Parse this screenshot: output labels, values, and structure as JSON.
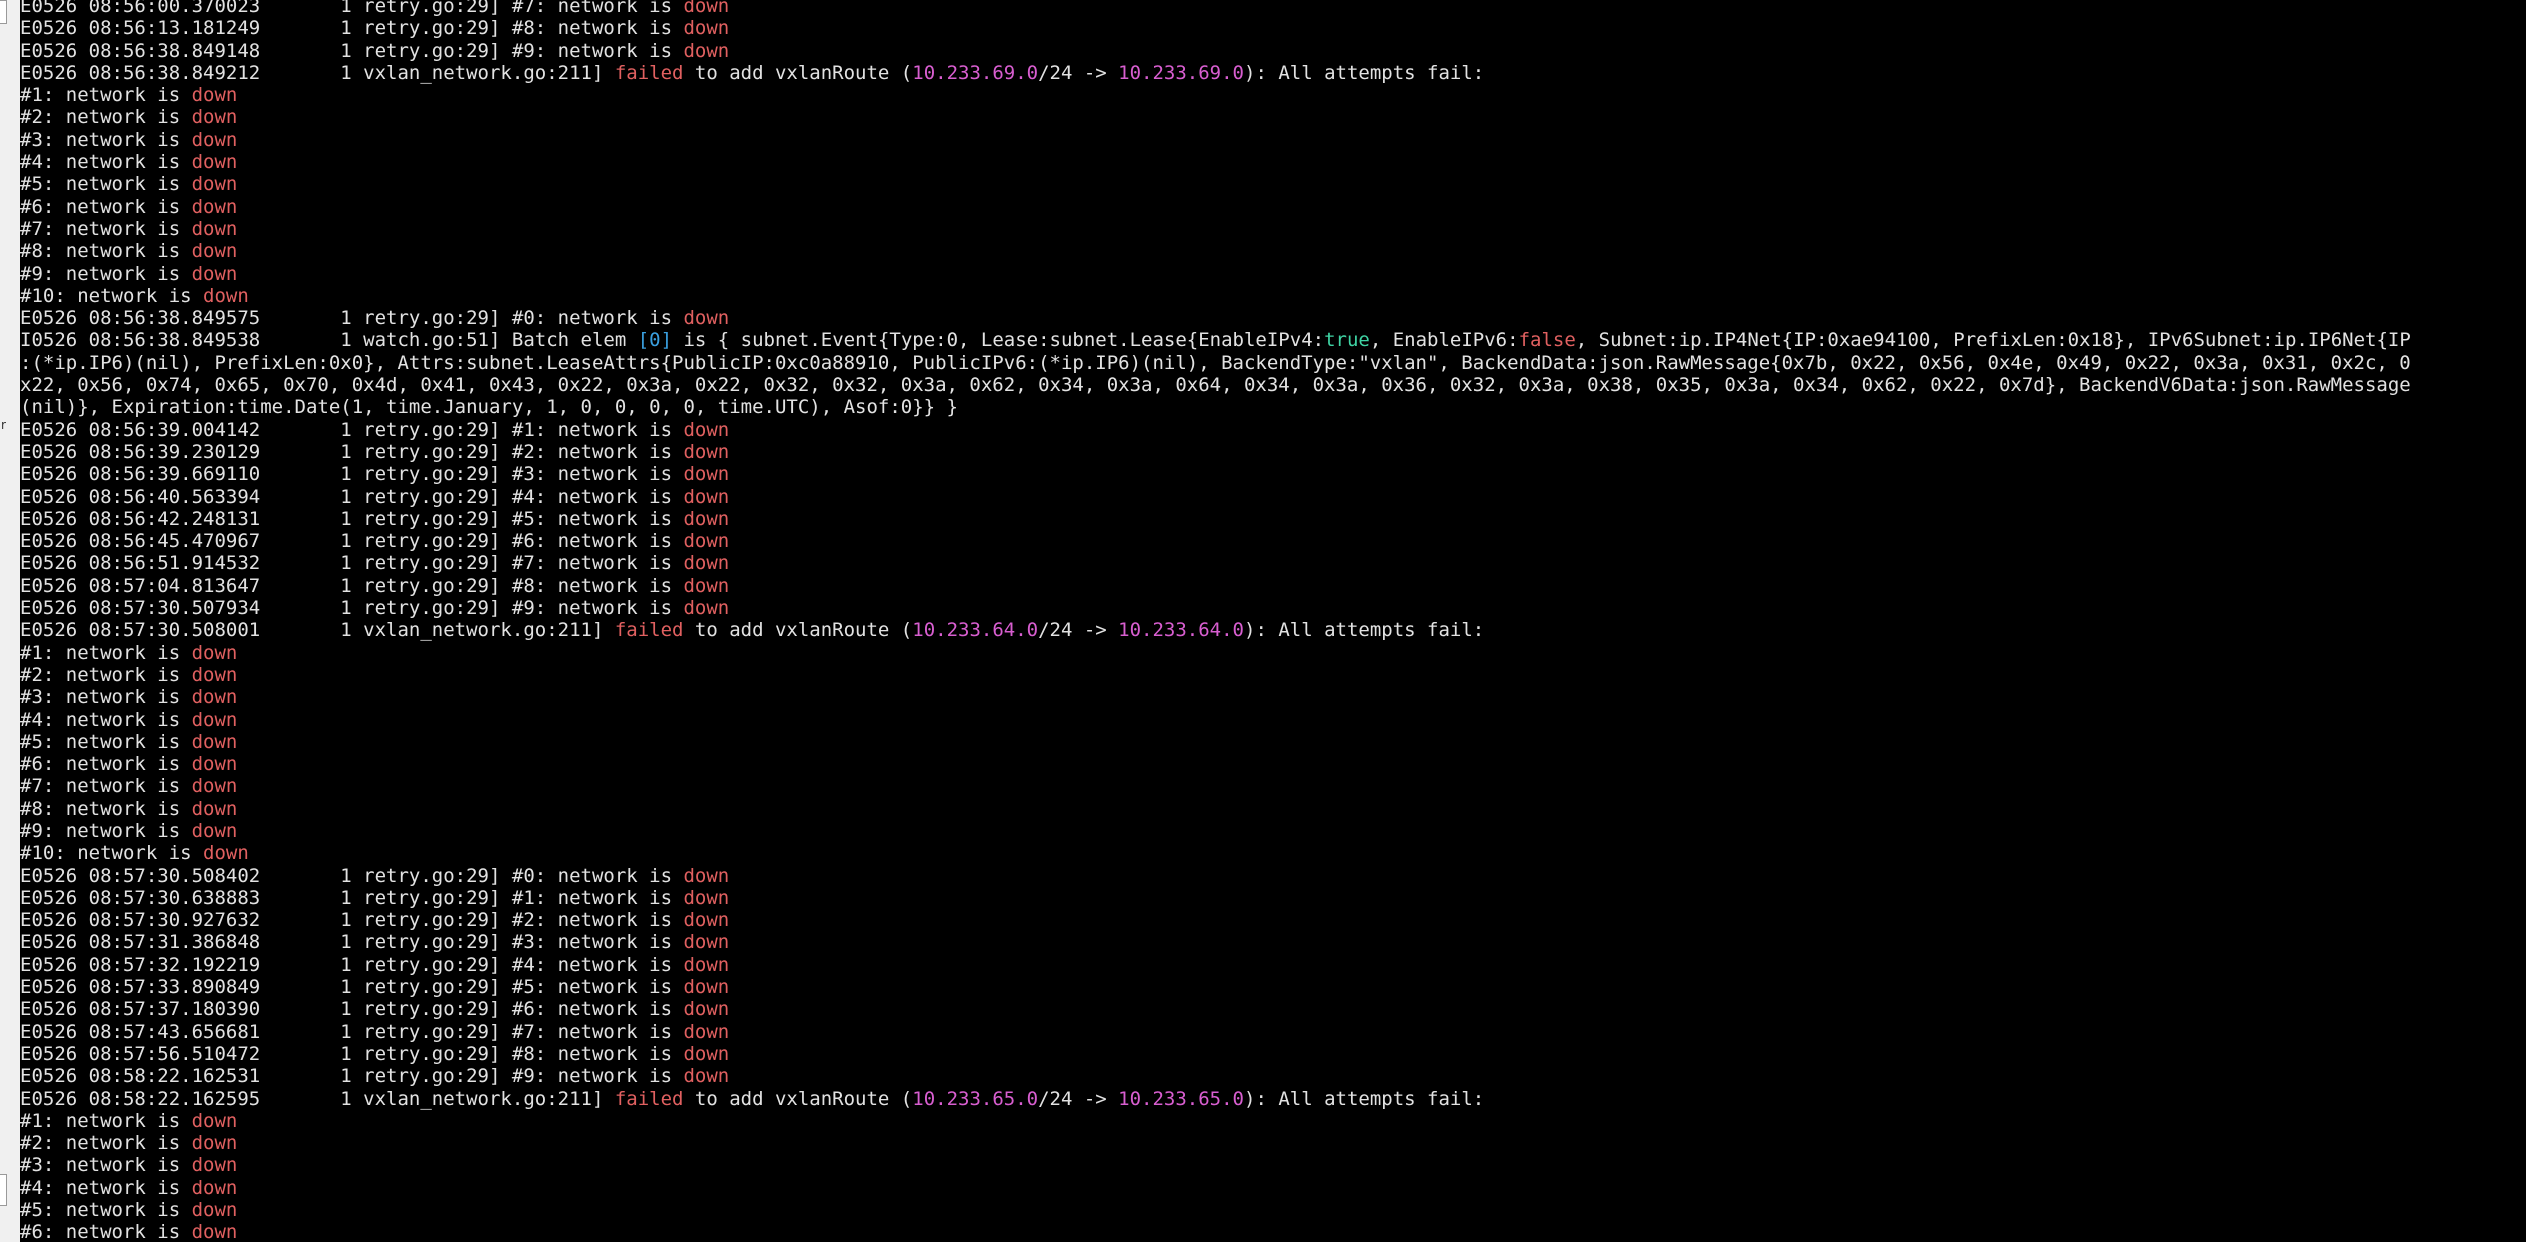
{
  "colors": {
    "background": "#000000",
    "text": "#e2e2e2",
    "red": "#e06060",
    "magenta": "#d85ed0",
    "green": "#3fd4a4",
    "cyan": "#3aa0e0"
  },
  "terminal": {
    "lines": [
      [
        [
          "E0526 08:56:00.370023       1 retry.go:29] #7: network is ",
          ""
        ],
        [
          "down",
          "red"
        ]
      ],
      [
        [
          "E0526 08:56:13.181249       1 retry.go:29] #8: network is ",
          ""
        ],
        [
          "down",
          "red"
        ]
      ],
      [
        [
          "E0526 08:56:38.849148       1 retry.go:29] #9: network is ",
          ""
        ],
        [
          "down",
          "red"
        ]
      ],
      [
        [
          "E0526 08:56:38.849212       1 vxlan_network.go:211] ",
          ""
        ],
        [
          "failed",
          "red"
        ],
        [
          " to add vxlanRoute (",
          ""
        ],
        [
          "10.233.69.0",
          "magenta"
        ],
        [
          "/24 -> ",
          ""
        ],
        [
          "10.233.69.0",
          "magenta"
        ],
        [
          "): All attempts fail:",
          ""
        ]
      ],
      [
        [
          "#1: network is ",
          ""
        ],
        [
          "down",
          "red"
        ]
      ],
      [
        [
          "#2: network is ",
          ""
        ],
        [
          "down",
          "red"
        ]
      ],
      [
        [
          "#3: network is ",
          ""
        ],
        [
          "down",
          "red"
        ]
      ],
      [
        [
          "#4: network is ",
          ""
        ],
        [
          "down",
          "red"
        ]
      ],
      [
        [
          "#5: network is ",
          ""
        ],
        [
          "down",
          "red"
        ]
      ],
      [
        [
          "#6: network is ",
          ""
        ],
        [
          "down",
          "red"
        ]
      ],
      [
        [
          "#7: network is ",
          ""
        ],
        [
          "down",
          "red"
        ]
      ],
      [
        [
          "#8: network is ",
          ""
        ],
        [
          "down",
          "red"
        ]
      ],
      [
        [
          "#9: network is ",
          ""
        ],
        [
          "down",
          "red"
        ]
      ],
      [
        [
          "#10: network is ",
          ""
        ],
        [
          "down",
          "red"
        ]
      ],
      [
        [
          "E0526 08:56:38.849575       1 retry.go:29] #0: network is ",
          ""
        ],
        [
          "down",
          "red"
        ]
      ],
      [
        [
          "I0526 08:56:38.849538       1 watch.go:51] Batch elem ",
          ""
        ],
        [
          "[0]",
          "cyan"
        ],
        [
          " is { subnet.Event{Type:0, Lease:subnet.Lease{EnableIPv4:",
          ""
        ],
        [
          "true",
          "green"
        ],
        [
          ", EnableIPv6:",
          ""
        ],
        [
          "false",
          "red"
        ],
        [
          ", Subnet:ip.IP4Net{IP:0xae94100, PrefixLen:0x18}, IPv6Subnet:ip.IP6Net{IP",
          ""
        ]
      ],
      [
        [
          ":(*ip.IP6)(nil), PrefixLen:0x0}, Attrs:subnet.LeaseAttrs{PublicIP:0xc0a88910, PublicIPv6:(*ip.IP6)(nil), BackendType:\"vxlan\", BackendData:json.RawMessage{0x7b, 0x22, 0x56, 0x4e, 0x49, 0x22, 0x3a, 0x31, 0x2c, 0",
          ""
        ]
      ],
      [
        [
          "x22, 0x56, 0x74, 0x65, 0x70, 0x4d, 0x41, 0x43, 0x22, 0x3a, 0x22, 0x32, 0x32, 0x3a, 0x62, 0x34, 0x3a, 0x64, 0x34, 0x3a, 0x36, 0x32, 0x3a, 0x38, 0x35, 0x3a, 0x34, 0x62, 0x22, 0x7d}, BackendV6Data:json.RawMessage",
          ""
        ]
      ],
      [
        [
          "(nil)}, Expiration:time.Date(1, time.January, 1, 0, 0, 0, 0, time.UTC), Asof:0}} }",
          ""
        ]
      ],
      [
        [
          "E0526 08:56:39.004142       1 retry.go:29] #1: network is ",
          ""
        ],
        [
          "down",
          "red"
        ]
      ],
      [
        [
          "E0526 08:56:39.230129       1 retry.go:29] #2: network is ",
          ""
        ],
        [
          "down",
          "red"
        ]
      ],
      [
        [
          "E0526 08:56:39.669110       1 retry.go:29] #3: network is ",
          ""
        ],
        [
          "down",
          "red"
        ]
      ],
      [
        [
          "E0526 08:56:40.563394       1 retry.go:29] #4: network is ",
          ""
        ],
        [
          "down",
          "red"
        ]
      ],
      [
        [
          "E0526 08:56:42.248131       1 retry.go:29] #5: network is ",
          ""
        ],
        [
          "down",
          "red"
        ]
      ],
      [
        [
          "E0526 08:56:45.470967       1 retry.go:29] #6: network is ",
          ""
        ],
        [
          "down",
          "red"
        ]
      ],
      [
        [
          "E0526 08:56:51.914532       1 retry.go:29] #7: network is ",
          ""
        ],
        [
          "down",
          "red"
        ]
      ],
      [
        [
          "E0526 08:57:04.813647       1 retry.go:29] #8: network is ",
          ""
        ],
        [
          "down",
          "red"
        ]
      ],
      [
        [
          "E0526 08:57:30.507934       1 retry.go:29] #9: network is ",
          ""
        ],
        [
          "down",
          "red"
        ]
      ],
      [
        [
          "E0526 08:57:30.508001       1 vxlan_network.go:211] ",
          ""
        ],
        [
          "failed",
          "red"
        ],
        [
          " to add vxlanRoute (",
          ""
        ],
        [
          "10.233.64.0",
          "magenta"
        ],
        [
          "/24 -> ",
          ""
        ],
        [
          "10.233.64.0",
          "magenta"
        ],
        [
          "): All attempts fail:",
          ""
        ]
      ],
      [
        [
          "#1: network is ",
          ""
        ],
        [
          "down",
          "red"
        ]
      ],
      [
        [
          "#2: network is ",
          ""
        ],
        [
          "down",
          "red"
        ]
      ],
      [
        [
          "#3: network is ",
          ""
        ],
        [
          "down",
          "red"
        ]
      ],
      [
        [
          "#4: network is ",
          ""
        ],
        [
          "down",
          "red"
        ]
      ],
      [
        [
          "#5: network is ",
          ""
        ],
        [
          "down",
          "red"
        ]
      ],
      [
        [
          "#6: network is ",
          ""
        ],
        [
          "down",
          "red"
        ]
      ],
      [
        [
          "#7: network is ",
          ""
        ],
        [
          "down",
          "red"
        ]
      ],
      [
        [
          "#8: network is ",
          ""
        ],
        [
          "down",
          "red"
        ]
      ],
      [
        [
          "#9: network is ",
          ""
        ],
        [
          "down",
          "red"
        ]
      ],
      [
        [
          "#10: network is ",
          ""
        ],
        [
          "down",
          "red"
        ]
      ],
      [
        [
          "E0526 08:57:30.508402       1 retry.go:29] #0: network is ",
          ""
        ],
        [
          "down",
          "red"
        ]
      ],
      [
        [
          "E0526 08:57:30.638883       1 retry.go:29] #1: network is ",
          ""
        ],
        [
          "down",
          "red"
        ]
      ],
      [
        [
          "E0526 08:57:30.927632       1 retry.go:29] #2: network is ",
          ""
        ],
        [
          "down",
          "red"
        ]
      ],
      [
        [
          "E0526 08:57:31.386848       1 retry.go:29] #3: network is ",
          ""
        ],
        [
          "down",
          "red"
        ]
      ],
      [
        [
          "E0526 08:57:32.192219       1 retry.go:29] #4: network is ",
          ""
        ],
        [
          "down",
          "red"
        ]
      ],
      [
        [
          "E0526 08:57:33.890849       1 retry.go:29] #5: network is ",
          ""
        ],
        [
          "down",
          "red"
        ]
      ],
      [
        [
          "E0526 08:57:37.180390       1 retry.go:29] #6: network is ",
          ""
        ],
        [
          "down",
          "red"
        ]
      ],
      [
        [
          "E0526 08:57:43.656681       1 retry.go:29] #7: network is ",
          ""
        ],
        [
          "down",
          "red"
        ]
      ],
      [
        [
          "E0526 08:57:56.510472       1 retry.go:29] #8: network is ",
          ""
        ],
        [
          "down",
          "red"
        ]
      ],
      [
        [
          "E0526 08:58:22.162531       1 retry.go:29] #9: network is ",
          ""
        ],
        [
          "down",
          "red"
        ]
      ],
      [
        [
          "E0526 08:58:22.162595       1 vxlan_network.go:211] ",
          ""
        ],
        [
          "failed",
          "red"
        ],
        [
          " to add vxlanRoute (",
          ""
        ],
        [
          "10.233.65.0",
          "magenta"
        ],
        [
          "/24 -> ",
          ""
        ],
        [
          "10.233.65.0",
          "magenta"
        ],
        [
          "): All attempts fail:",
          ""
        ]
      ],
      [
        [
          "#1: network is ",
          ""
        ],
        [
          "down",
          "red"
        ]
      ],
      [
        [
          "#2: network is ",
          ""
        ],
        [
          "down",
          "red"
        ]
      ],
      [
        [
          "#3: network is ",
          ""
        ],
        [
          "down",
          "red"
        ]
      ],
      [
        [
          "#4: network is ",
          ""
        ],
        [
          "down",
          "red"
        ]
      ],
      [
        [
          "#5: network is ",
          ""
        ],
        [
          "down",
          "red"
        ]
      ],
      [
        [
          "#6: network is ",
          ""
        ],
        [
          "down",
          "red"
        ]
      ]
    ]
  },
  "left_strip": {
    "glyph": "r"
  }
}
